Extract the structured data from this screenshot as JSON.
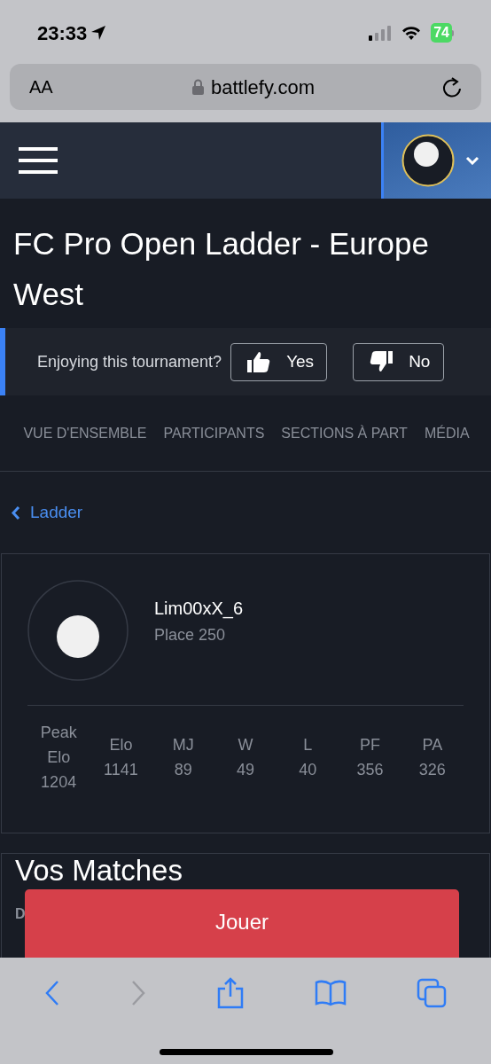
{
  "status_bar": {
    "time": "23:33",
    "battery": "74"
  },
  "address_bar": {
    "text_size": "AA",
    "url": "battlefy.com"
  },
  "title": "FC Pro Open Ladder - Europe West",
  "feedback": {
    "question": "Enjoying this tournament?",
    "buttons": [
      {
        "kind": "like",
        "label": "Yes"
      },
      {
        "kind": "dislike",
        "label": "No"
      }
    ]
  },
  "tabs": [
    {
      "label": "VUE D'ENSEMBLE",
      "selected": false
    },
    {
      "label": "PARTICIPANTS",
      "selected": false
    },
    {
      "label": "SECTIONS À PART",
      "selected": false
    },
    {
      "label": "MÉDIA",
      "selected": false
    }
  ],
  "back_link": "Ladder",
  "player": {
    "name": "Lim00xX_6",
    "place": "Place 250"
  },
  "stats": [
    {
      "label": "Peak Elo",
      "value": "1204"
    },
    {
      "label": "Elo",
      "value": "1141"
    },
    {
      "label": "MJ",
      "value": "89"
    },
    {
      "label": "W",
      "value": "49"
    },
    {
      "label": "L",
      "value": "40"
    },
    {
      "label": "PF",
      "value": "356"
    },
    {
      "label": "PA",
      "value": "326"
    }
  ],
  "matches": {
    "heading": "Vos Matches",
    "column_1": "D"
  },
  "play_button": "Jouer"
}
